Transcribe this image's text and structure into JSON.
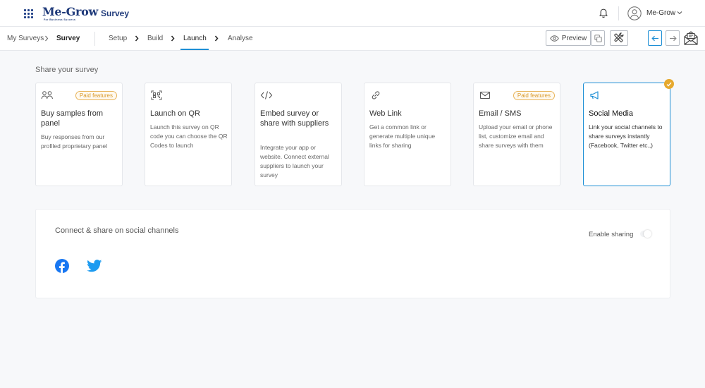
{
  "header": {
    "logo_text": "Me-Grow",
    "logo_tagline": "For Business Success",
    "app_name": "Survey",
    "user_name": "Me-Grow"
  },
  "nav": {
    "breadcrumb": [
      "My Surveys",
      "Survey"
    ],
    "steps": [
      "Setup",
      "Build",
      "Launch",
      "Analyse"
    ],
    "active_step": "Launch",
    "preview_label": "Preview"
  },
  "section": {
    "title": "Share your survey"
  },
  "cards": [
    {
      "icon": "people-icon",
      "title": "Buy samples from panel",
      "desc": "Buy responses from our profiled proprietary panel",
      "paid": "Paid features",
      "selected": false
    },
    {
      "icon": "qr-code-icon",
      "title": "Launch on QR",
      "desc": "Launch this survey on QR code you can choose the QR Codes to launch",
      "paid": "",
      "selected": false
    },
    {
      "icon": "code-icon",
      "title": "Embed survey or share with suppliers",
      "desc": "Integrate your app or website. Connect external suppliers to launch your survey",
      "paid": "",
      "selected": false
    },
    {
      "icon": "link-icon",
      "title": "Web Link",
      "desc": "Get a common link or generate multiple unique links for sharing",
      "paid": "",
      "selected": false
    },
    {
      "icon": "envelope-icon",
      "title": "Email / SMS",
      "desc": "Upload your email or phone list, customize email and share surveys with them",
      "paid": "Paid features",
      "selected": false
    },
    {
      "icon": "megaphone-icon",
      "title": "Social Media",
      "desc": "Link your social channels to share surveys instantly (Facebook, Twitter etc.,)",
      "paid": "",
      "selected": true
    }
  ],
  "panel": {
    "title": "Connect & share on social channels",
    "enable_label": "Enable sharing",
    "enable_on": false,
    "channels": [
      "facebook-icon",
      "twitter-icon"
    ]
  },
  "colors": {
    "accent": "#1e8fd5",
    "brand": "#1f3a7a",
    "paid": "#d99a2b",
    "check": "#e6a92e",
    "facebook": "#1877f2",
    "twitter": "#1d9bf0"
  }
}
